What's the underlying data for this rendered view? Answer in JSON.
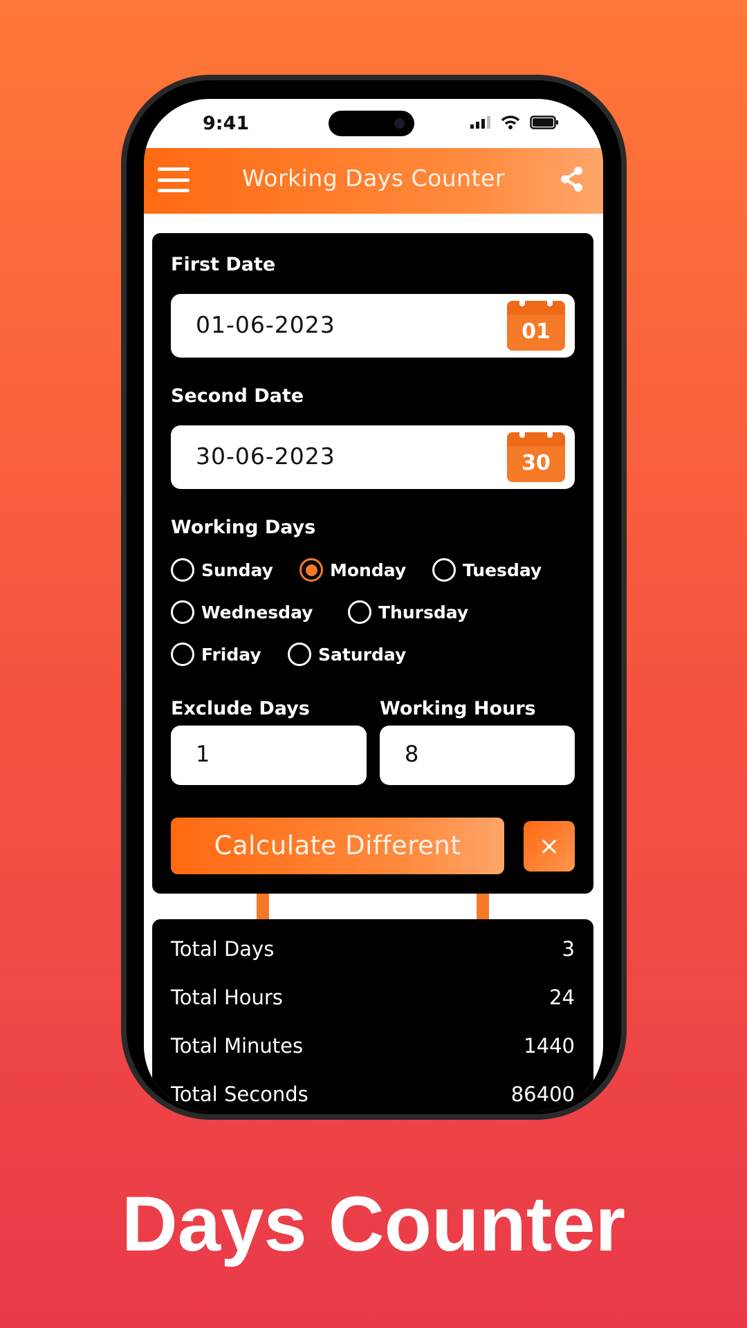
{
  "status_bar": {
    "time": "9:41",
    "icons": [
      "signal-icon",
      "wifi-icon",
      "battery-icon"
    ]
  },
  "app_bar": {
    "title": "Working Days Counter",
    "menu_icon": "menu-icon",
    "share_icon": "share-icon"
  },
  "form": {
    "first_date": {
      "label": "First Date",
      "value": "01-06-2023",
      "icon_day": "01"
    },
    "second_date": {
      "label": "Second Date",
      "value": "30-06-2023",
      "icon_day": "30"
    },
    "working_days": {
      "label": "Working Days",
      "options": [
        {
          "label": "Sunday",
          "selected": false
        },
        {
          "label": "Monday",
          "selected": true
        },
        {
          "label": "Tuesday",
          "selected": false
        },
        {
          "label": "Wednesday",
          "selected": false
        },
        {
          "label": "Thursday",
          "selected": false
        },
        {
          "label": "Friday",
          "selected": false
        },
        {
          "label": "Saturday",
          "selected": false
        }
      ]
    },
    "exclude_days": {
      "label": "Exclude Days",
      "value": "1"
    },
    "working_hours": {
      "label": "Working Hours",
      "value": "8"
    },
    "calculate_label": "Calculate Different",
    "clear_label": "×"
  },
  "results": [
    {
      "label": "Total Days",
      "value": "3"
    },
    {
      "label": "Total Hours",
      "value": "24"
    },
    {
      "label": "Total Minutes",
      "value": "1440"
    },
    {
      "label": "Total Seconds",
      "value": "86400"
    }
  ],
  "caption": "Days Counter",
  "colors": {
    "accent": "#f47a28",
    "card": "#000000",
    "bg_top": "#ff7838",
    "bg_bottom": "#e93a4a"
  }
}
